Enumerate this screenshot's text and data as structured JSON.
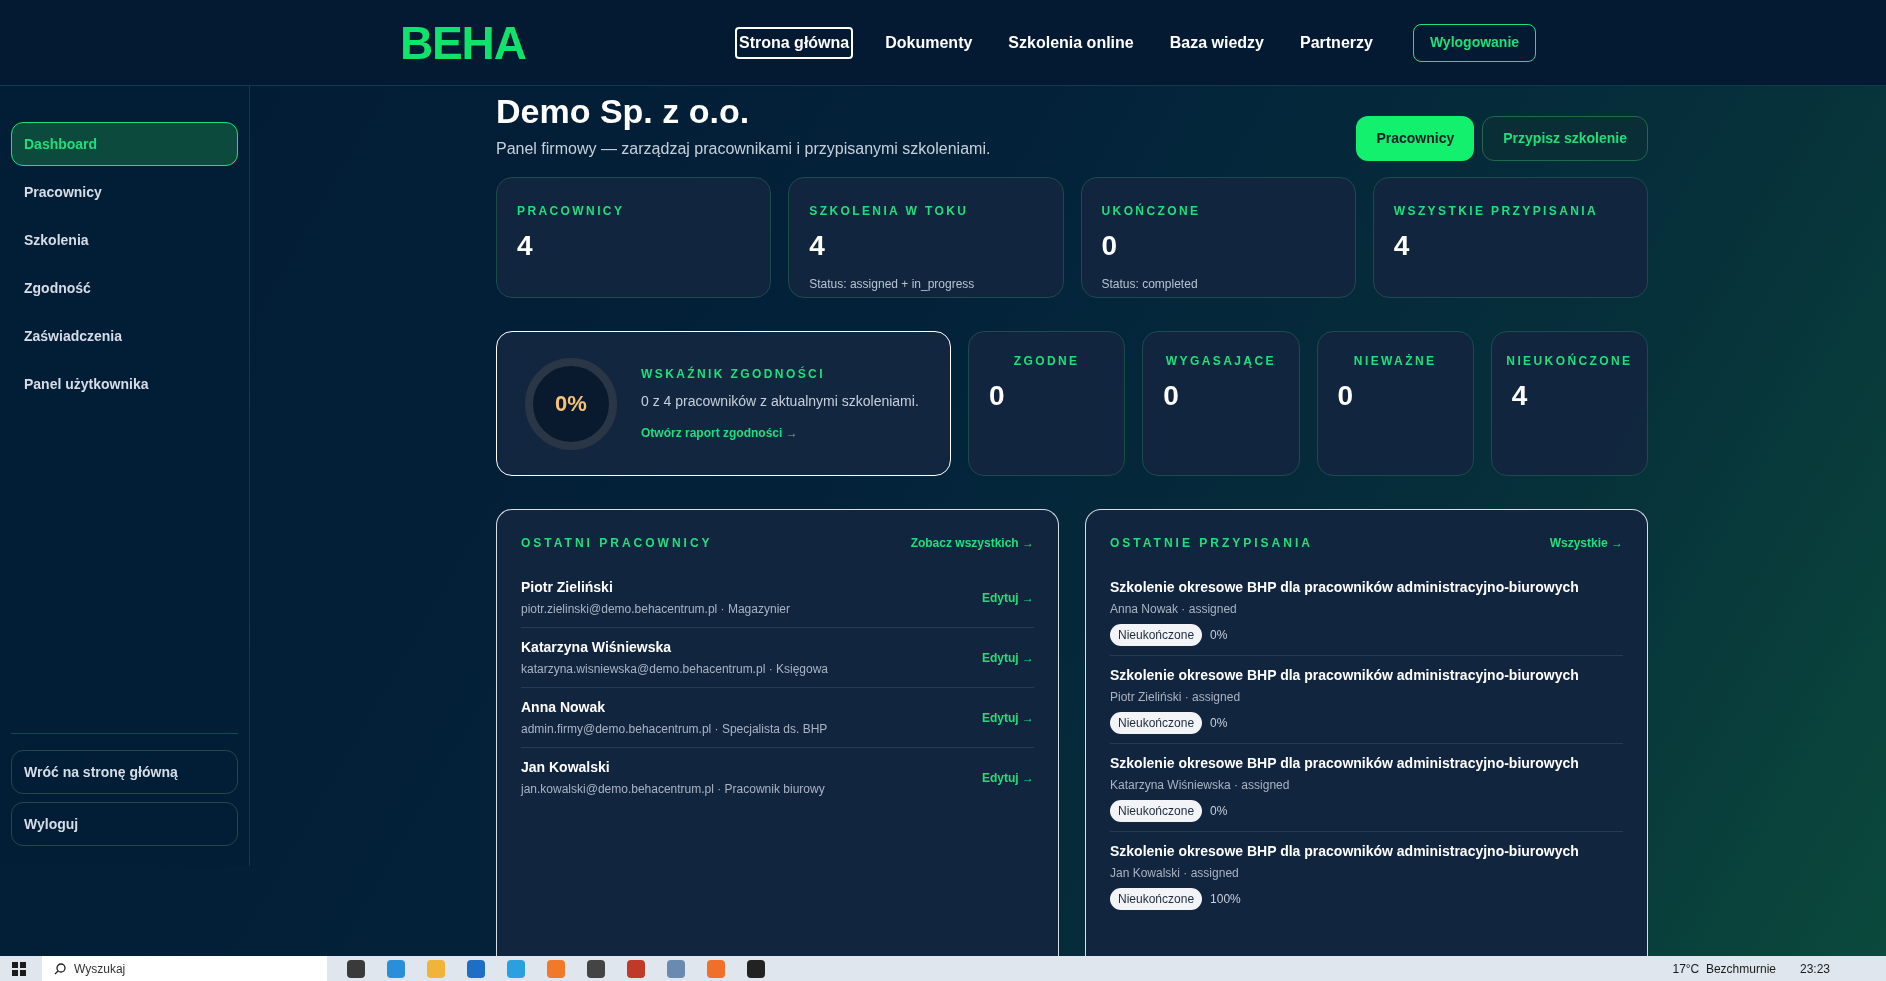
{
  "header": {
    "logo": "BEHA",
    "nav": [
      {
        "label": "Strona główna",
        "selected": true
      },
      {
        "label": "Dokumenty",
        "selected": false
      },
      {
        "label": "Szkolenia online",
        "selected": false
      },
      {
        "label": "Baza wiedzy",
        "selected": false
      },
      {
        "label": "Partnerzy",
        "selected": false
      }
    ],
    "logout": "Wylogowanie"
  },
  "sidebar": {
    "items": [
      {
        "label": "Dashboard",
        "selected": true
      },
      {
        "label": "Pracownicy",
        "selected": false
      },
      {
        "label": "Szkolenia",
        "selected": false
      },
      {
        "label": "Zgodność",
        "selected": false
      },
      {
        "label": "Zaświadczenia",
        "selected": false
      },
      {
        "label": "Panel użytkownika",
        "selected": false
      }
    ],
    "bottom": [
      "Wróć na stronę główną",
      "Wyloguj"
    ]
  },
  "page": {
    "title": "Demo Sp. z o.o.",
    "subtitle": "Panel firmowy — zarządzaj pracownikami i przypisanymi szkoleniami.",
    "actions": [
      {
        "label": "Pracownicy",
        "kind": "primary"
      },
      {
        "label": "Przypisz szkolenie",
        "kind": "outline"
      }
    ]
  },
  "stats": [
    {
      "label": "PRACOWNICY",
      "value": "4"
    },
    {
      "label": "SZKOLENIA W TOKU",
      "value": "4",
      "note": "Status: assigned + in_progress"
    },
    {
      "label": "UKOŃCZONE",
      "value": "0",
      "note": "Status: completed"
    },
    {
      "label": "WSZYSTKIE PRZYPISANIA",
      "value": "4"
    }
  ],
  "compliance": {
    "percent": "0%",
    "title": "WSKAŹNIK ZGODNOŚCI",
    "text": "0 z 4 pracowników z aktualnymi szkoleniami.",
    "link": "Otwórz raport zgodności →"
  },
  "compliance_stats": [
    {
      "label": "ZGODNE",
      "value": "0"
    },
    {
      "label": "WYGASAJĄCE",
      "value": "0"
    },
    {
      "label": "NIEWAŻNE",
      "value": "0"
    },
    {
      "label": "NIEUKOŃCZONE",
      "value": "4"
    }
  ],
  "recent_employees": {
    "title": "OSTATNI PRACOWNICY",
    "link": "Zobacz wszystkich →",
    "rows": [
      {
        "name": "Piotr Zieliński",
        "details": "piotr.zielinski@demo.behacentrum.pl · Magazynier",
        "action": "Edytuj →"
      },
      {
        "name": "Katarzyna Wiśniewska",
        "details": "katarzyna.wisniewska@demo.behacentrum.pl · Księgowa",
        "action": "Edytuj →"
      },
      {
        "name": "Anna Nowak",
        "details": "admin.firmy@demo.behacentrum.pl · Specjalista ds. BHP",
        "action": "Edytuj →"
      },
      {
        "name": "Jan Kowalski",
        "details": "jan.kowalski@demo.behacentrum.pl · Pracownik biurowy",
        "action": "Edytuj →"
      }
    ]
  },
  "recent_assignments": {
    "title": "OSTATNIE PRZYPISANIA",
    "link": "Wszystkie →",
    "rows": [
      {
        "course": "Szkolenie okresowe BHP dla pracowników administracyjno-biurowych",
        "details": "Anna Nowak · assigned",
        "status": "Nieukończone",
        "progress": "0%"
      },
      {
        "course": "Szkolenie okresowe BHP dla pracowników administracyjno-biurowych",
        "details": "Piotr Zieliński · assigned",
        "status": "Nieukończone",
        "progress": "0%"
      },
      {
        "course": "Szkolenie okresowe BHP dla pracowników administracyjno-biurowych",
        "details": "Katarzyna Wiśniewska · assigned",
        "status": "Nieukończone",
        "progress": "0%"
      },
      {
        "course": "Szkolenie okresowe BHP dla pracowników administracyjno-biurowych",
        "details": "Jan Kowalski · assigned",
        "status": "Nieukończone",
        "progress": "100%"
      }
    ]
  },
  "taskbar": {
    "search": "Wyszukaj",
    "weather": "17°C  Bezchmurnie",
    "time": "23:23"
  }
}
